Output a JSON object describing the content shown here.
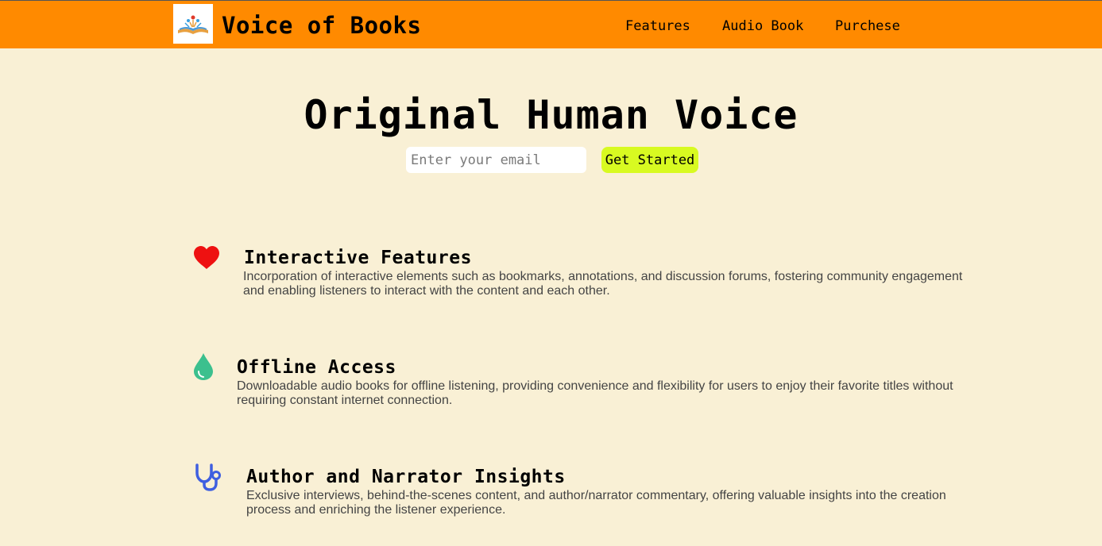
{
  "header": {
    "brand": "Voice of Books",
    "logo_icon": "open-book-logo-icon",
    "nav": [
      {
        "label": "Features"
      },
      {
        "label": "Audio Book"
      },
      {
        "label": "Purchese"
      }
    ]
  },
  "hero": {
    "title": "Original Human Voice",
    "email_placeholder": "Enter your email",
    "cta_label": "Get Started"
  },
  "features": [
    {
      "icon": "heart-icon",
      "title": "Interactive Features",
      "description": "Incorporation of interactive elements such as bookmarks, annotations, and discussion forums, fostering community engagement and enabling listeners to interact with the content and each other."
    },
    {
      "icon": "water-drop-icon",
      "title": "Offline Access",
      "description": "Downloadable audio books for offline listening, providing convenience and flexibility for users to enjoy their favorite titles without requiring constant internet connection."
    },
    {
      "icon": "stethoscope-icon",
      "title": "Author and Narrator Insights",
      "description": "Exclusive interviews, behind-the-scenes content, and author/narrator commentary, offering valuable insights into the creation process and enriching the listener experience."
    }
  ],
  "colors": {
    "header_bg": "#ff8a00",
    "page_bg": "#f9f0d5",
    "cta_bg": "#d8fa21",
    "heart": "#ee1111",
    "drop": "#3cc08e",
    "stethoscope": "#3f5fe0"
  }
}
